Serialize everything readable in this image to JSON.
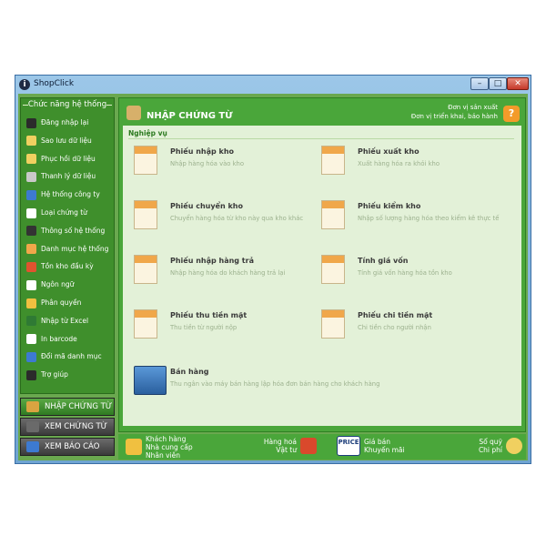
{
  "window": {
    "title": "ShopClick",
    "app_icon": "i",
    "minimize": "–",
    "maximize": "□",
    "close": "✕"
  },
  "sidebar": {
    "title": "Chức năng hệ thống",
    "items": [
      {
        "label": "Đăng nhập lại",
        "icon": "login-icon",
        "color": "#2b2b2b"
      },
      {
        "label": "Sao lưu dữ liệu",
        "icon": "backup-icon",
        "color": "#f0d060"
      },
      {
        "label": "Phục hồi dữ liệu",
        "icon": "restore-icon",
        "color": "#f0d060"
      },
      {
        "label": "Thanh lý dữ liệu",
        "icon": "trash-icon",
        "color": "#c9c9c9"
      },
      {
        "label": "Hệ thống công ty",
        "icon": "company-icon",
        "color": "#3d7ad1"
      },
      {
        "label": "Loại chứng từ",
        "icon": "document-type-icon",
        "color": "#ffffff"
      },
      {
        "label": "Thông số hệ thống",
        "icon": "settings-icon",
        "color": "#333333"
      },
      {
        "label": "Danh mục hệ thống",
        "icon": "list-icon",
        "color": "#f0a74a"
      },
      {
        "label": "Tồn kho đầu kỳ",
        "icon": "inventory-icon",
        "color": "#e0532f"
      },
      {
        "label": "Ngôn ngữ",
        "icon": "language-icon",
        "color": "#ffffff"
      },
      {
        "label": "Phân quyền",
        "icon": "permission-icon",
        "color": "#f0c040"
      },
      {
        "label": "Nhập từ Excel",
        "icon": "excel-icon",
        "color": "#2f7a34"
      },
      {
        "label": "In barcode",
        "icon": "barcode-icon",
        "color": "#ffffff"
      },
      {
        "label": "Đổi mã danh mục",
        "icon": "change-code-icon",
        "color": "#3d7ad1"
      },
      {
        "label": "Trợ giúp",
        "icon": "help-icon",
        "color": "#2b2b2b"
      }
    ],
    "buttons": [
      {
        "label": "NHẬP CHỨNG TỪ",
        "active": true
      },
      {
        "label": "XEM CHỨNG TỪ",
        "active": false
      },
      {
        "label": "XEM BÁO CÁO",
        "active": false
      }
    ]
  },
  "header": {
    "title": "NHẬP CHỨNG TỪ",
    "right_line1": "Đơn vị sản xuất",
    "right_line2": "Đơn vị triển khai, bảo hành",
    "help": "?"
  },
  "section": "Nghiệp vụ",
  "tiles": [
    {
      "title": "Phiếu nhập kho",
      "desc": "Nhập hàng hóa vào kho"
    },
    {
      "title": "Phiếu xuất kho",
      "desc": "Xuất hàng hóa ra khỏi kho"
    },
    {
      "title": "Phiếu chuyển kho",
      "desc": "Chuyển hàng hóa từ kho này qua kho khác"
    },
    {
      "title": "Phiếu kiểm kho",
      "desc": "Nhập số lượng hàng hóa theo kiểm kê thực tế"
    },
    {
      "title": "Phiếu nhập hàng trả",
      "desc": "Nhập hàng hóa do khách hàng trả lại"
    },
    {
      "title": "Tính giá vốn",
      "desc": "Tính giá vốn hàng hóa tồn kho"
    },
    {
      "title": "Phiếu thu tiền mặt",
      "desc": "Thu tiền từ người nộp"
    },
    {
      "title": "Phiếu chi tiền mặt",
      "desc": "Chi tiền cho người nhận"
    },
    {
      "title": "Bán hàng",
      "desc": "Thu ngân vào máy bán hàng lập hóa đơn bán hàng cho khách hàng"
    }
  ],
  "bottom": {
    "customers": [
      "Khách hàng",
      "Nhà cung cấp",
      "Nhân viên"
    ],
    "goods": [
      "Hàng hoá",
      "Vật tư"
    ],
    "price_icon": "PRICE",
    "prices": [
      "Giá bán",
      "Khuyến mãi"
    ],
    "cashbook": [
      "Sổ quỹ",
      "Chi phí"
    ]
  }
}
